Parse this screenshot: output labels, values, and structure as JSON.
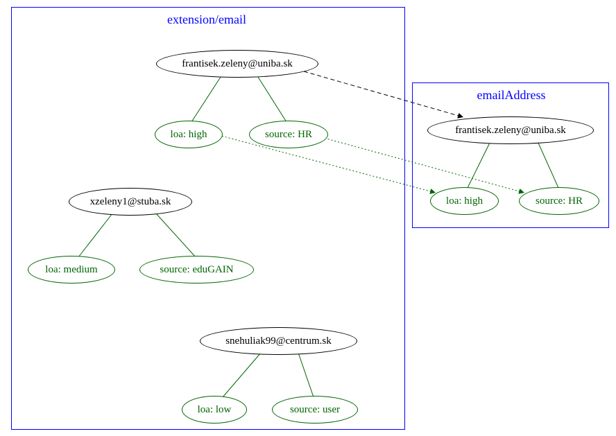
{
  "clusters": {
    "left": {
      "label": "extension/email"
    },
    "right": {
      "label": "emailAddress"
    }
  },
  "left_tree": {
    "value1": {
      "email": "frantisek.zeleny@uniba.sk",
      "loa": "loa: high",
      "source": "source: HR"
    },
    "value2": {
      "email": "xzeleny1@stuba.sk",
      "loa": "loa: medium",
      "source": "source: eduGAIN"
    },
    "value3": {
      "email": "snehuliak99@centrum.sk",
      "loa": "loa: low",
      "source": "source: user"
    }
  },
  "right_tree": {
    "value": {
      "email": "frantisek.zeleny@uniba.sk",
      "loa": "loa: high",
      "source": "source: HR"
    }
  }
}
